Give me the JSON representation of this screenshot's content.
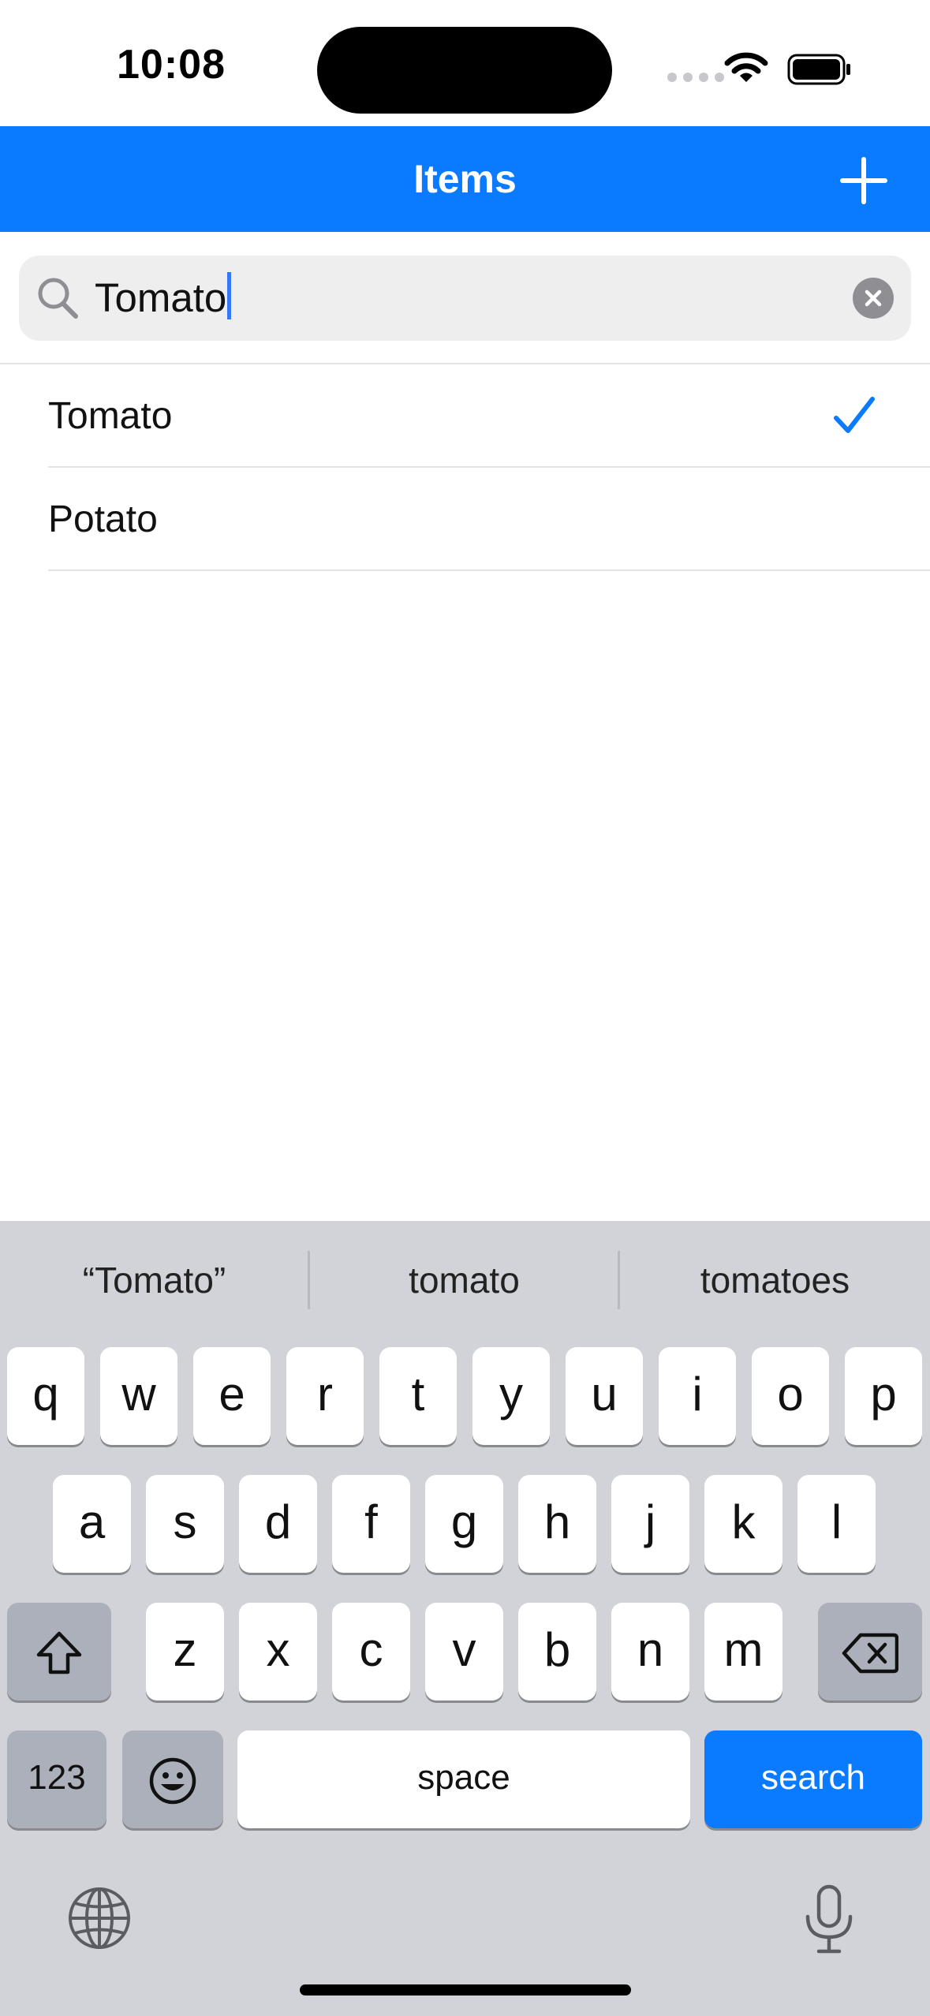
{
  "status": {
    "time": "10:08"
  },
  "nav": {
    "title": "Items",
    "add_icon": "plus-icon",
    "bg_color": "#0a7aff"
  },
  "search": {
    "value": "Tomato",
    "icon": "magnifier-icon",
    "clear_icon": "clear-x-icon"
  },
  "list": {
    "items": [
      {
        "label": "Tomato",
        "checked": true
      },
      {
        "label": "Potato",
        "checked": false
      }
    ]
  },
  "keyboard": {
    "suggestions": [
      "“Tomato”",
      "tomato",
      "tomatoes"
    ],
    "row1": [
      "q",
      "w",
      "e",
      "r",
      "t",
      "y",
      "u",
      "i",
      "o",
      "p"
    ],
    "row2": [
      "a",
      "s",
      "d",
      "f",
      "g",
      "h",
      "j",
      "k",
      "l"
    ],
    "row3": [
      "z",
      "x",
      "c",
      "v",
      "b",
      "n",
      "m"
    ],
    "numbers_label": "123",
    "space_label": "space",
    "search_label": "search"
  }
}
